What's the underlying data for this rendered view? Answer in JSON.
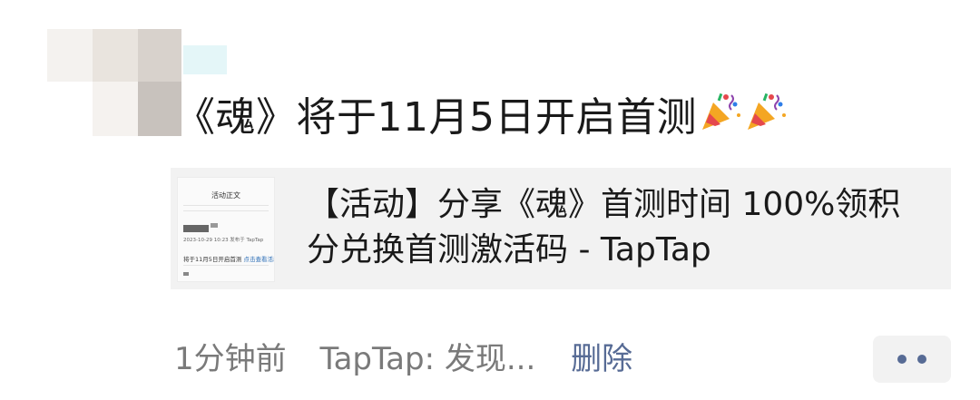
{
  "post": {
    "text": "《魂》将于11月5日开启首测",
    "emojis": [
      "party-popper-icon",
      "party-popper-icon"
    ]
  },
  "card": {
    "title": "【活动】分享《魂》首测时间 100%领积分兑换首测激活码 - TapTap",
    "thumbnail": {
      "heading": "活动正文",
      "date_line": "2023-10-29 10:23 发布于 TapTap",
      "text_line": "将于11月5日开启首测",
      "link_text": "点击查看活动"
    }
  },
  "meta": {
    "time": "1分钟前",
    "source": "TapTap: 发现...",
    "delete_label": "删除"
  },
  "colors": {
    "link": "#576b95",
    "card_bg": "#f2f2f2",
    "meta_text": "#7a7a7a"
  }
}
